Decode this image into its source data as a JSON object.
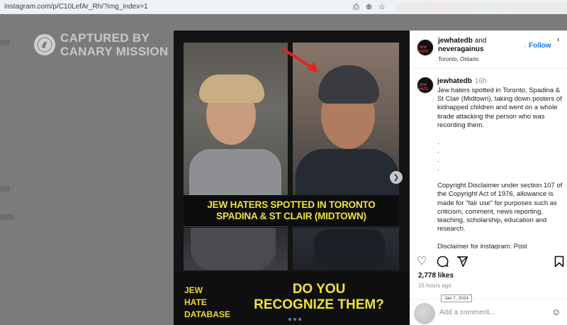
{
  "browser": {
    "url": "instagram.com/p/C10LefAr_Rh/?img_index=1",
    "icons": [
      "screenshot-icon",
      "zoom-icon",
      "bookmark-star-icon"
    ]
  },
  "watermark": {
    "line1": "CAPTURED BY",
    "line2": "CANARY MISSION"
  },
  "post_image": {
    "caption_line1": "JEW HATERS SPOTTED IN TORONTO",
    "caption_line2": "SPADINA & ST CLAIR (MIDTOWN)",
    "logo_line1": "JEW",
    "logo_line2": "HATE",
    "logo_line3": "DATABASE",
    "cta_line1": "DO YOU",
    "cta_line2": "RECOGNIZE THEM?",
    "next_icon": "chevron-right-icon",
    "slide_count": 3,
    "active_slide": 1,
    "accent_color": "#f0e33a"
  },
  "header": {
    "user1": "jewhatedb",
    "and_text": "and",
    "user2": "neveragainus",
    "location": "Toronto, Ontario",
    "follow_dot": "·",
    "follow_label": "Follow",
    "more_label": "...",
    "avatar_text": "JEW HATE"
  },
  "caption": {
    "author": "jewhatedb",
    "time": "16h",
    "text": "Jew haters spotted in Toronto, Spadina & St Clair (Midtown), taking down posters of kidnapped children and went on a whole tirade attacking the person who was recording them.\n\n.\n.\n.\n.\n\nCopyright Disclaimer under section 107 of the Copyright Act of 1976, allowance is made for \"fair use\" for purposes such as criticism, comment, news reporting, teaching, scholarship, education and research.\n\nDisclaimer for instagram: Post"
  },
  "actions": {
    "like_icon": "heart-icon",
    "comment_icon": "comment-icon",
    "share_icon": "send-icon",
    "save_icon": "bookmark-icon"
  },
  "stats": {
    "likes": "2,778 likes",
    "posted": "16 hours ago",
    "date_tooltip": "Jan 7, 2024"
  },
  "comment_box": {
    "placeholder": "Add a comment...",
    "emoji_icon": "smiley-icon"
  }
}
